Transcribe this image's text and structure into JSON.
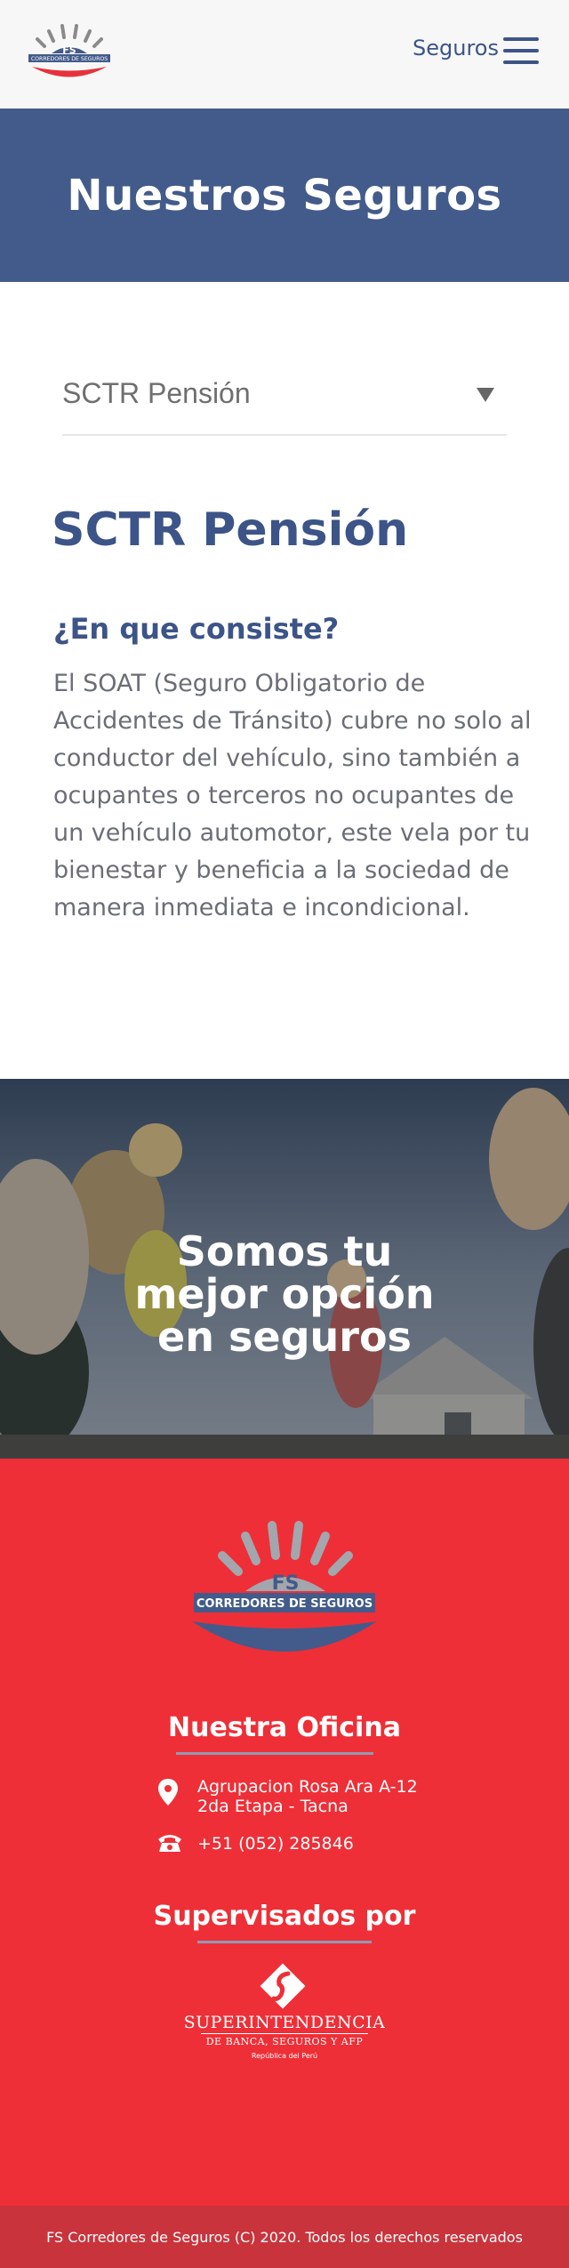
{
  "header": {
    "logo_text": "FS",
    "logo_subtext": "CORREDORES DE SEGUROS",
    "nav_label": "Seguros"
  },
  "banner": {
    "title": "Nuestros Seguros"
  },
  "selector": {
    "selected": "SCTR Pensión"
  },
  "product": {
    "title": "SCTR Pensión",
    "question": "¿En que consiste?",
    "description": "El SOAT (Seguro Obligatorio de Accidentes de Tránsito) cubre no solo al conductor del vehículo, sino también a ocupantes o terceros no ocupantes de un vehículo automotor, este vela por tu bienestar y beneficia a la sociedad de manera inmediata e incondicional."
  },
  "hero": {
    "line1": "Somos tu",
    "line2": "mejor opción",
    "line3": "en seguros"
  },
  "footer": {
    "logo_text": "FS",
    "logo_subtext": "CORREDORES DE SEGUROS",
    "office_title": "Nuestra Oficina",
    "address_line1": "Agrupacion Rosa Ara A-12",
    "address_line2": "2da Etapa - Tacna",
    "phone": "+51 (052) 285846",
    "supervised_title": "Supervisados por",
    "sbs_line1": "SUPERINTENDENCIA",
    "sbs_line2": "DE BANCA, SEGUROS Y AFP",
    "sbs_line3": "República del Perú",
    "copyright": "FS Corredores de Seguros (C) 2020. Todos los derechos reservados"
  },
  "colors": {
    "brand_blue": "#435b8a",
    "brand_red": "#ee2f37",
    "copyright_bar": "#c9343c"
  },
  "icons": {
    "menu": "hamburger-menu-icon",
    "dropdown": "triangle-down-icon",
    "address": "map-pin-icon",
    "phone": "telephone-icon"
  }
}
